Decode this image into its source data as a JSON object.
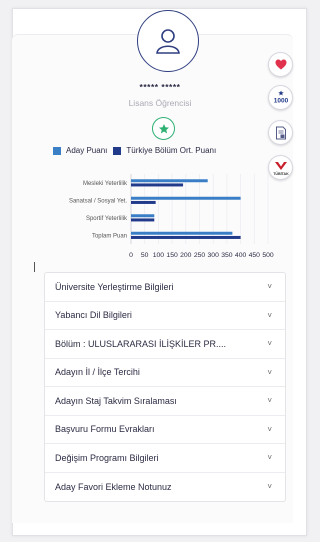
{
  "profile": {
    "name": "***** *****",
    "role": "Lisans Öğrencisi"
  },
  "icons": {
    "avatar": "user-icon",
    "favorite": "heart-icon",
    "rank_badge": "1000",
    "document": "document-icon",
    "tubitak": "TÜBİTAK",
    "star": "star-icon"
  },
  "colors": {
    "aday": "#3a7fc6",
    "turkiye": "#223a8a",
    "heart": "#e0314d",
    "star": "#2fb174"
  },
  "legend": {
    "aday": "Aday Puanı",
    "turkiye": "Türkiye Bölüm Ort. Puanı"
  },
  "chart_data": {
    "type": "bar",
    "orientation": "horizontal",
    "categories": [
      "Mesleki Yeterlilik",
      "Sanatsal / Sosyal Yet.",
      "Sportif Yeterlilik",
      "Toplam Puan"
    ],
    "series": [
      {
        "name": "Aday Puanı",
        "values": [
          280,
          400,
          85,
          370
        ]
      },
      {
        "name": "Türkiye Bölüm Ort. Puanı",
        "values": [
          190,
          90,
          85,
          400
        ]
      }
    ],
    "xticks": [
      "0",
      "50",
      "100",
      "150",
      "200",
      "250",
      "300",
      "350",
      "400",
      "450",
      "500"
    ],
    "xlim": [
      0,
      500
    ],
    "grid": true
  },
  "accordion": [
    {
      "label": "Üniversite Yerleştirme Bilgileri"
    },
    {
      "label": "Yabancı Dil Bilgileri"
    },
    {
      "label": "Bölüm : ULUSLARARASI İLİŞKİLER PR...."
    },
    {
      "label": "Adayın İl / İlçe Tercihi"
    },
    {
      "label": "Adayın Staj Takvim Sıralaması"
    },
    {
      "label": "Başvuru Formu Evrakları"
    },
    {
      "label": "Değişim Programı Bilgileri"
    },
    {
      "label": "Aday Favori Ekleme Notunuz"
    }
  ]
}
